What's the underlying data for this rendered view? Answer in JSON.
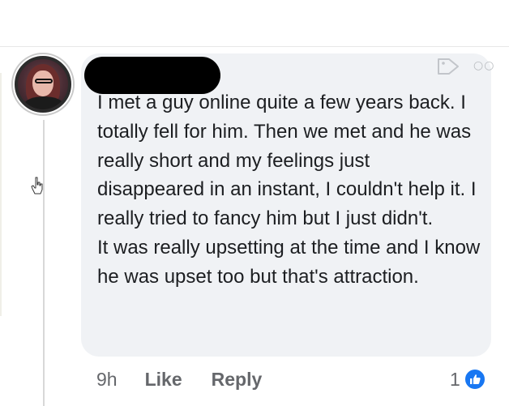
{
  "comment": {
    "text": "I met a guy online quite a few years back. I totally fell for him. Then we met and he was really short and my feelings just disappeared in an instant, I couldn't help it. I really tried to fancy him but I just didn't.\nIt was really upsetting at the time and I know he was upset too but that's attraction.",
    "timestamp": "9h",
    "reaction_count": "1"
  },
  "actions": {
    "like_label": "Like",
    "reply_label": "Reply"
  },
  "icons": {
    "avatar": "profile-avatar",
    "tag": "tag-icon",
    "more": "more-options-icon",
    "cursor": "hand-cursor-icon",
    "reaction": "thumbs-up-reaction-icon"
  },
  "colors": {
    "bubble_background": "#f0f2f5",
    "text": "#1c1e21",
    "meta_text": "#65676b",
    "like_blue": "#1877f2",
    "redaction": "#000000"
  }
}
